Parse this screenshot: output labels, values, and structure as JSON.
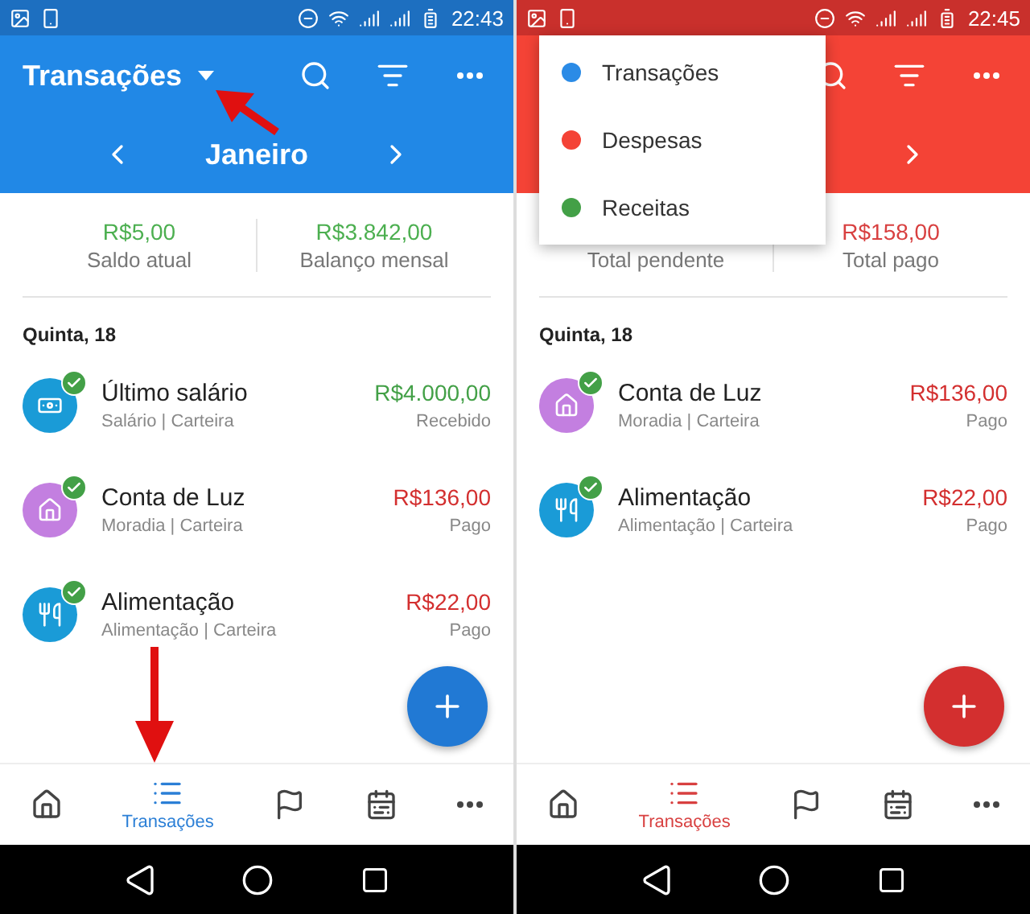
{
  "screens": [
    {
      "kind": "all",
      "annotated": true,
      "status_bar": {
        "time": "22:43"
      },
      "app_bar": {
        "title": "Transações",
        "month": "Janeiro"
      },
      "summary": [
        {
          "value": "R$5,00",
          "label": "Saldo atual"
        },
        {
          "value": "R$3.842,00",
          "label": "Balanço mensal"
        }
      ],
      "day": "Quinta, 18",
      "transactions": [
        {
          "title": "Último salário",
          "subtitle": "Salário | Carteira",
          "amount": "R$4.000,00",
          "status": "Recebido",
          "kind": "salary",
          "color": "#1a9bd7",
          "checked": true
        },
        {
          "title": "Conta de Luz",
          "subtitle": "Moradia | Carteira",
          "amount": "R$136,00",
          "status": "Pago",
          "kind": "housing",
          "color": "#c37fe0",
          "checked": true
        },
        {
          "title": "Alimentação",
          "subtitle": "Alimentação | Carteira",
          "amount": "R$22,00",
          "status": "Pago",
          "kind": "food",
          "color": "#1a9bd7",
          "checked": true
        }
      ],
      "nav": [
        {
          "selected": false
        },
        {
          "label": "Transações",
          "selected": true
        },
        {
          "selected": false
        },
        {
          "selected": false
        },
        {
          "selected": false
        }
      ]
    },
    {
      "kind": "expenses",
      "status_bar": {
        "time": "22:45"
      },
      "menu": [
        {
          "label": "Transações",
          "color": "#2b8be6"
        },
        {
          "label": "Despesas",
          "color": "#f44336"
        },
        {
          "label": "Receitas",
          "color": "#43a047"
        }
      ],
      "summary": [
        {
          "label": "Total pendente"
        },
        {
          "value": "R$158,00",
          "label": "Total pago"
        }
      ],
      "day": "Quinta, 18",
      "transactions": [
        {
          "title": "Conta de Luz",
          "subtitle": "Moradia | Carteira",
          "amount": "R$136,00",
          "status": "Pago",
          "kind": "housing",
          "color": "#c37fe0",
          "checked": true
        },
        {
          "title": "Alimentação",
          "subtitle": "Alimentação | Carteira",
          "amount": "R$22,00",
          "status": "Pago",
          "kind": "food",
          "color": "#1a9bd7",
          "checked": true
        }
      ],
      "nav": [
        {
          "selected": false
        },
        {
          "label": "Transações",
          "selected": true
        },
        {
          "selected": false
        },
        {
          "selected": false
        },
        {
          "selected": false
        }
      ]
    }
  ]
}
